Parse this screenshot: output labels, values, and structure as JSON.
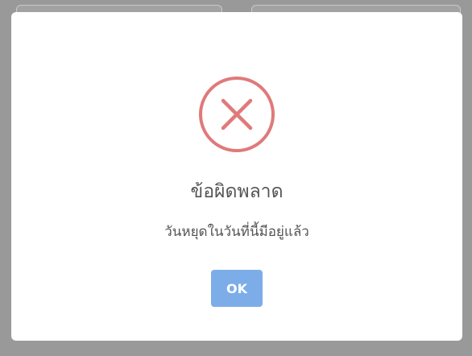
{
  "dialog": {
    "title": "ข้อผิดพลาด",
    "message": "วันหยุดในวันที่นี้มีอยู่แล้ว",
    "ok_label": "OK",
    "icon": "error-x-icon"
  },
  "colors": {
    "error_red": "#e07a7a",
    "ok_button": "#7cade9",
    "text": "#545454",
    "overlay": "#999999"
  }
}
